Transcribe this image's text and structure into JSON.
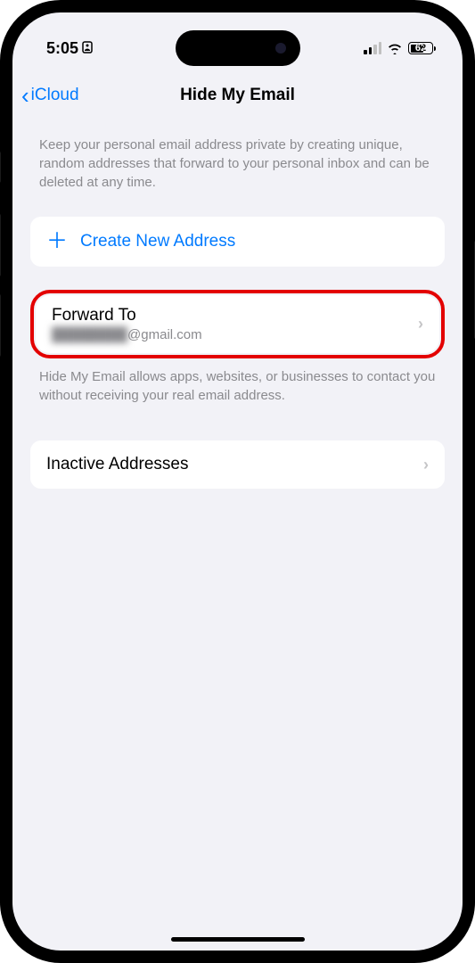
{
  "statusBar": {
    "time": "5:05",
    "batteryPercent": "62"
  },
  "nav": {
    "backLabel": "iCloud",
    "title": "Hide My Email"
  },
  "intro": "Keep your personal email address private by creating unique, random addresses that forward to your personal inbox and can be deleted at any time.",
  "createButton": {
    "label": "Create New Address"
  },
  "forwardTo": {
    "title": "Forward To",
    "emailHidden": "████████",
    "emailDomain": "@gmail.com"
  },
  "forwardFooter": "Hide My Email allows apps, websites, or businesses to contact you without receiving your real email address.",
  "inactive": {
    "title": "Inactive Addresses"
  }
}
